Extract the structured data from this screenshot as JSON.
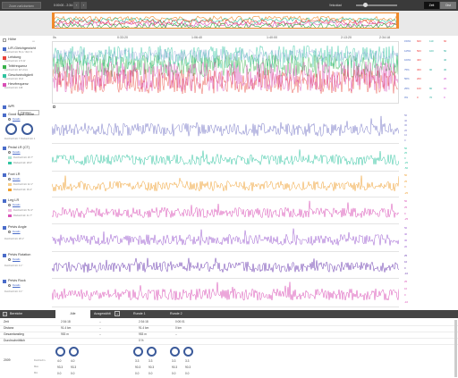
{
  "toolbar": {
    "zoom_label": "Zoom zurücksetzen",
    "range": "0:00:00 - 2:34:18",
    "prev": "‹",
    "next": "›",
    "speed_label": "Velocidad",
    "time_label": "Zeit",
    "dist_label": "Dist"
  },
  "time_axis": [
    "0s",
    "0:33:20",
    "1:06:40",
    "1:40:00",
    "2:13:20",
    "2:34:18"
  ],
  "overview_chart": {
    "chart_data": {
      "type": "area",
      "series": [
        {
          "name": "overview",
          "color": "#f08a2c"
        }
      ]
    }
  },
  "left_panel": {
    "hoehe": {
      "label": "Höhe"
    },
    "lr_balance": {
      "label": "L/R-Gleichgewicht",
      "sub": "Durchschnitt: 50,4 / 49,6 %"
    },
    "leistung": {
      "label": "Leistung",
      "sub": "Durchschnitt: 172 W"
    },
    "trittfrequenz": {
      "label": "Trittfrequenz",
      "sub": "Durchschnitt: 92 U/min"
    },
    "geschwindigkeit": {
      "label": "Geschwindigkeit",
      "sub": "Durchschnitt: 36,8"
    },
    "herzfrequenz": {
      "label": "Herzfrequenz",
      "sub": "Durchschnitt: 138"
    },
    "wpi": {
      "label": "WPI"
    },
    "wpi_select": "Trimmen",
    "good_spot": {
      "label": "Good Spot Score",
      "link": "Details",
      "sub": "Durchschnitt: 7  Rückschnitt: 1"
    },
    "pedal_lr": {
      "label": "Pedal LR (CT)",
      "link": "Details",
      "legend1": "Durchschnitt: 26.7°",
      "legend2": "Rückschnitt: 28.6°"
    },
    "foot_lr": {
      "label": "Foot LR",
      "link": "Details",
      "legend1": "Durchschnitt: 42.1°",
      "legend2": "Rückschnitt: 36.4°"
    },
    "leg_lr": {
      "label": "Leg LR",
      "link": "Details",
      "legend1": "Durchschnitt: 51.3°",
      "legend2": "Rückschnitt: 41.7°"
    },
    "pelvis_angle": {
      "label": "Pelvis Angle",
      "link": "Details",
      "sub": "Durchschnitt: 28.1°"
    },
    "pelvis_rotation": {
      "label": "Pelvis Rotation",
      "link": "Details",
      "sub": "Durchschnitt: 4.1°"
    },
    "pelvis_rock": {
      "label": "Pelvis Rock",
      "link": "Details",
      "sub": "Durchschnitt: 3.1°"
    }
  },
  "main_chart": {
    "right_values": [
      {
        "label": "150%",
        "v": "600",
        "a": "110",
        "b": "60",
        "color": "#e33"
      },
      {
        "label": "125%",
        "v": "500",
        "a": "100",
        "b": "50",
        "color": "#2a9"
      },
      {
        "label": "100%",
        "v": "400",
        "a": "",
        "b": "40",
        "color": "#2a9"
      },
      {
        "label": "75%",
        "v": "300",
        "a": "90",
        "b": "30",
        "color": "#2a9"
      },
      {
        "label": "50%",
        "v": "200",
        "a": "",
        "b": "20",
        "color": "#c3c"
      },
      {
        "label": "25%",
        "v": "100",
        "a": "80",
        "b": "10",
        "color": "#c3c"
      },
      {
        "label": "0%",
        "v": "0",
        "a": "70",
        "b": "0",
        "color": "#c3c"
      }
    ],
    "chart_data": {
      "type": "line",
      "series": [
        {
          "name": "Geschwindigkeit",
          "color": "#2fc4a0"
        },
        {
          "name": "Trittfrequenz",
          "color": "#38b24a"
        },
        {
          "name": "Leistung",
          "color": "#e8443a"
        },
        {
          "name": "Herzfrequenz",
          "color": "#d94fb6"
        },
        {
          "name": "L/R-Gleichgewicht",
          "color": "#8aa0d8"
        }
      ]
    }
  },
  "sub_charts": [
    {
      "key": "good_spot",
      "color": "#7a7ac8",
      "ticks": [
        "50",
        "40",
        "30",
        "20",
        "10",
        "0"
      ]
    },
    {
      "key": "pedal_lr",
      "color": "#2fc4a0",
      "ticks": [
        "50",
        "25",
        "0",
        "-25",
        "-50"
      ]
    },
    {
      "key": "foot_lr",
      "color": "#f0a030",
      "ticks": [
        "50",
        "25",
        "0",
        "-25"
      ]
    },
    {
      "key": "leg_lr",
      "color": "#d94fb6",
      "ticks": [
        "50",
        "25",
        "0",
        "-25"
      ]
    },
    {
      "key": "pelvis_angle",
      "color": "#9a5ad0",
      "ticks": [
        "50",
        "40",
        "30",
        "20"
      ]
    },
    {
      "key": "pelvis_rotation",
      "color": "#6a3ab0",
      "ticks": [
        "25",
        "10",
        "0",
        "-10"
      ]
    },
    {
      "key": "pelvis_rock",
      "color": "#d94fb6",
      "ticks": [
        "25",
        "10",
        "0",
        "-10"
      ]
    }
  ],
  "table": {
    "header_label": "Bereiche",
    "tabs": [
      "Alle",
      "Ausgewählt",
      "+",
      "Runde 1",
      "Runde 2"
    ],
    "rows": [
      {
        "label": "Zeit",
        "values": [
          "2:34:18",
          "--",
          "2:34:18",
          "0:00:01"
        ]
      },
      {
        "label": "Distanz",
        "values": [
          "91.4 km",
          "--",
          "91.4 km",
          "0 km"
        ]
      },
      {
        "label": "Gesamtanstieg",
        "values": [
          "953 m",
          "--",
          "953 m",
          "--"
        ]
      },
      {
        "label": "Durchschnittlich",
        "values": [
          "",
          "",
          "0 %",
          ""
        ]
      }
    ],
    "metric_label": "2009",
    "stats": [
      {
        "label": "Durchschn.",
        "values": [
          "4.0",
          "3.3",
          "4.0",
          "3.3"
        ]
      },
      {
        "label": "Max",
        "values": [
          "93.3",
          "90.3",
          "93.3",
          "90.3"
        ]
      },
      {
        "label": "Min",
        "values": [
          "0.0",
          "0.0",
          "0.0",
          "0.0"
        ]
      }
    ]
  }
}
